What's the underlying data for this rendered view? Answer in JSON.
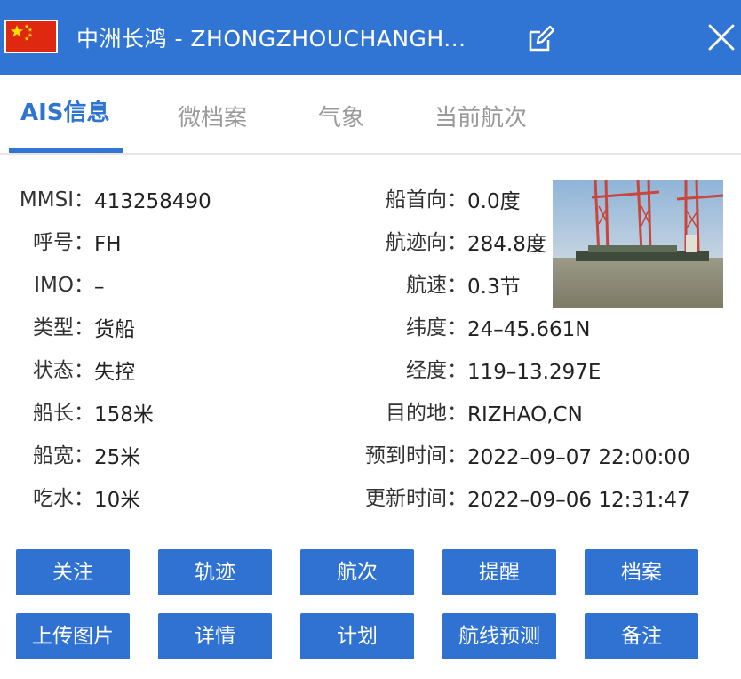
{
  "header": {
    "title": "中洲长鸿 -  ZHONGZHOUCHANGH...",
    "flag_icon": "china-flag-icon",
    "edit_icon": "edit-icon",
    "close_icon": "close-icon",
    "bg_color": "#3075d4"
  },
  "tabs": [
    {
      "label": "AIS信息",
      "active": true
    },
    {
      "label": "微档案",
      "active": false
    },
    {
      "label": "气象",
      "active": false
    },
    {
      "label": "当前航次",
      "active": false
    }
  ],
  "info_left": [
    {
      "label": "MMSI：",
      "value": "413258490"
    },
    {
      "label": "呼号：",
      "value": "FH"
    },
    {
      "label": "IMO：",
      "value": "–"
    },
    {
      "label": "类型：",
      "value": "货船"
    },
    {
      "label": "状态：",
      "value": "失控"
    },
    {
      "label": "船长：",
      "value": "158米"
    },
    {
      "label": "船宽：",
      "value": "25米"
    },
    {
      "label": "吃水：",
      "value": "10米"
    }
  ],
  "info_right": [
    {
      "label": "船首向：",
      "value": "0.0度"
    },
    {
      "label": "航迹向：",
      "value": "284.8度"
    },
    {
      "label": "航速：",
      "value": "0.3节"
    },
    {
      "label": "纬度：",
      "value": "24–45.661N"
    },
    {
      "label": "经度：",
      "value": "119–13.297E"
    },
    {
      "label": "目的地：",
      "value": "RIZHAO,CN"
    },
    {
      "label": "预到时间：",
      "value": "2022–09–07 22:00:00"
    },
    {
      "label": "更新时间：",
      "value": "2022–09–06 12:31:47"
    }
  ],
  "buttons_row1": [
    "关注",
    "轨迹",
    "航次",
    "提醒",
    "档案"
  ],
  "buttons_row2": [
    "上传图片",
    "详情",
    "计划",
    "航线预测",
    "备注"
  ],
  "button_color": "#2f72d2",
  "accent_color": "#2f74d0"
}
